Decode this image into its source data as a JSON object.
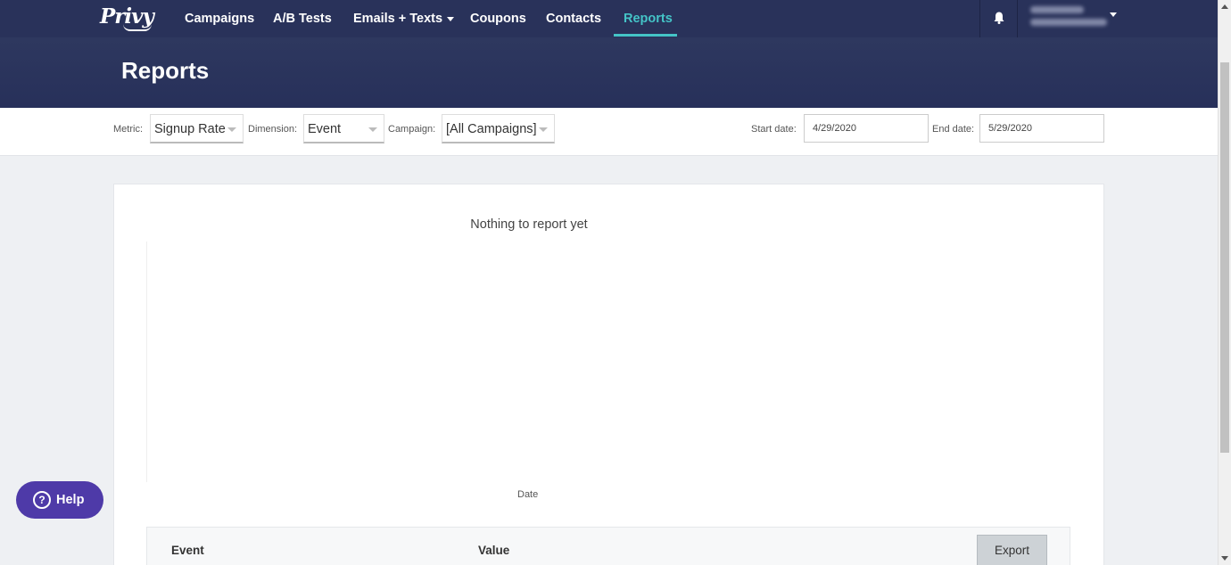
{
  "nav": {
    "logo": "Privy",
    "items": [
      {
        "label": "Campaigns"
      },
      {
        "label": "A/B Tests"
      },
      {
        "label": "Emails + Texts"
      },
      {
        "label": "Coupons"
      },
      {
        "label": "Contacts"
      },
      {
        "label": "Reports",
        "active": true
      }
    ],
    "active_color": "#44c4c7",
    "bar_color": "#29325a"
  },
  "page": {
    "title": "Reports"
  },
  "filters": {
    "metric_label": "Metric:",
    "metric_value": "Signup Rate",
    "dimension_label": "Dimension:",
    "dimension_value": "Event",
    "campaign_label": "Campaign:",
    "campaign_value": "[All Campaigns]",
    "start_label": "Start date:",
    "start_value": "4/29/2020",
    "end_label": "End date:",
    "end_value": "5/29/2020"
  },
  "report": {
    "empty_message": "Nothing to report yet",
    "x_axis_label": "Date",
    "columns": [
      "Event",
      "Value"
    ],
    "export_label": "Export"
  },
  "help": {
    "label": "Help",
    "color": "#4e3aa8"
  }
}
